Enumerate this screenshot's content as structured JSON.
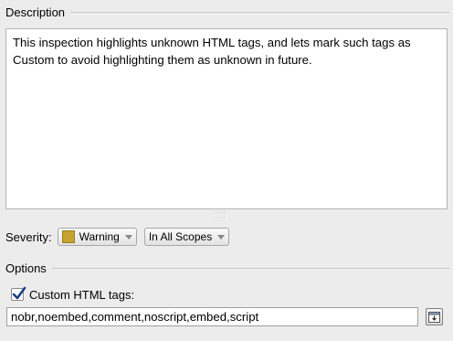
{
  "description": {
    "header": "Description",
    "text": "This inspection highlights unknown HTML tags, and lets mark such tags as Custom to avoid highlighting them as unknown in future."
  },
  "severity": {
    "label": "Severity:",
    "level": "Warning",
    "level_color": "#c6a22e",
    "scope": "In All Scopes"
  },
  "options": {
    "header": "Options",
    "custom_tags_checkbox": {
      "label": "Custom HTML tags:",
      "checked": true
    },
    "custom_tags_value": "nobr,noembed,comment,noscript,embed,script",
    "browse_icon": "browse-icon"
  }
}
